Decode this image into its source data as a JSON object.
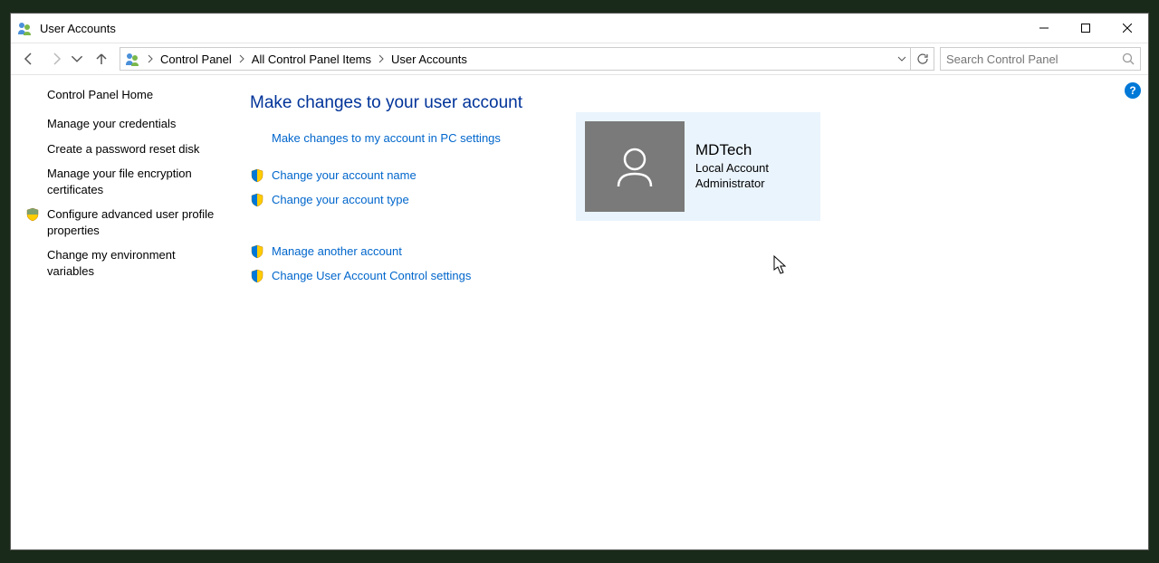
{
  "window": {
    "title": "User Accounts"
  },
  "breadcrumb": {
    "items": [
      "Control Panel",
      "All Control Panel Items",
      "User Accounts"
    ]
  },
  "search": {
    "placeholder": "Search Control Panel"
  },
  "sidebar": {
    "home": "Control Panel Home",
    "links": [
      {
        "label": "Manage your credentials",
        "shield": false
      },
      {
        "label": "Create a password reset disk",
        "shield": false
      },
      {
        "label": "Manage your file encryption certificates",
        "shield": false
      },
      {
        "label": "Configure advanced user profile properties",
        "shield": true
      },
      {
        "label": "Change my environment variables",
        "shield": false
      }
    ]
  },
  "main": {
    "heading": "Make changes to your user account",
    "pc_settings_link": "Make changes to my account in PC settings",
    "actions_top": [
      {
        "label": "Change your account name",
        "shield": true
      },
      {
        "label": "Change your account type",
        "shield": true
      }
    ],
    "actions_bottom": [
      {
        "label": "Manage another account",
        "shield": true
      },
      {
        "label": "Change User Account Control settings",
        "shield": true
      }
    ]
  },
  "user": {
    "name": "MDTech",
    "type": "Local Account",
    "role": "Administrator"
  },
  "help_glyph": "?"
}
